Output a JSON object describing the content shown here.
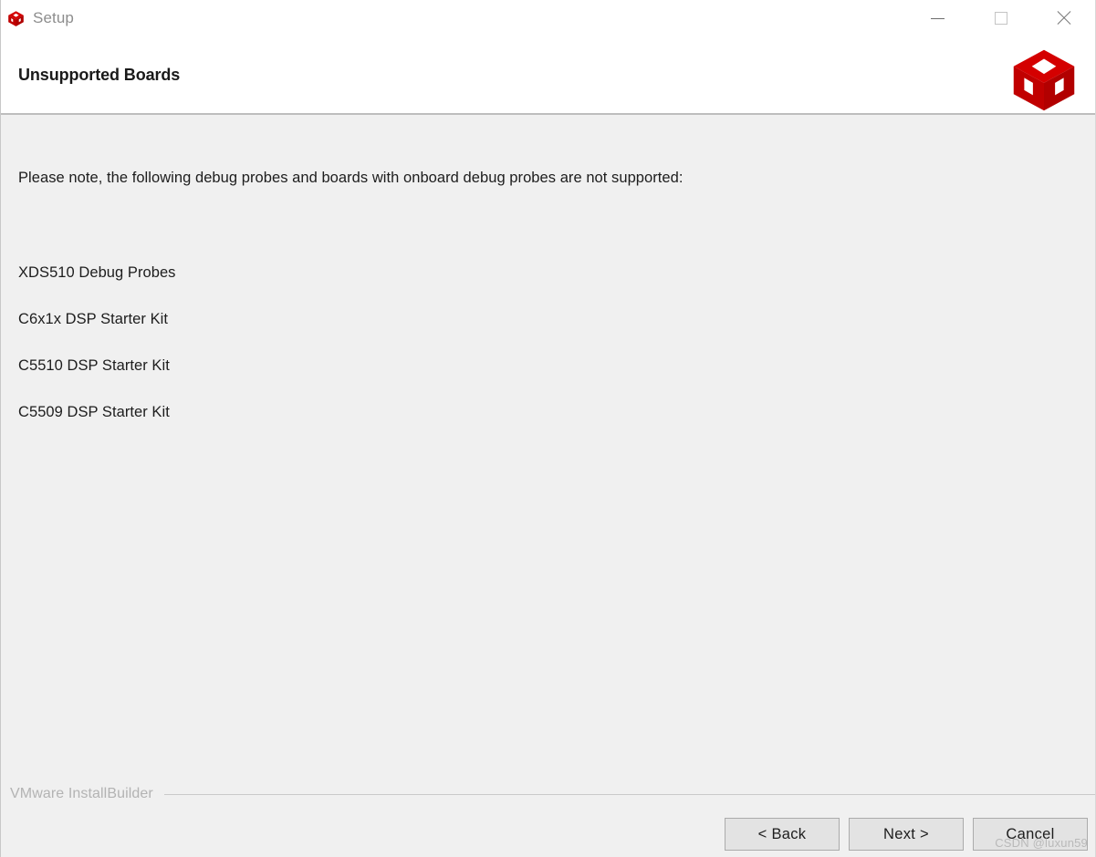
{
  "window": {
    "title": "Setup",
    "app_icon": "red-cube-icon",
    "controls": {
      "minimize": "minimize-icon",
      "maximize": "maximize-icon",
      "close": "close-icon"
    }
  },
  "header": {
    "title": "Unsupported Boards",
    "logo": "red-cube-logo",
    "logo_color": "#cc0000"
  },
  "main": {
    "intro": "Please note, the following debug probes and boards with onboard debug probes are not supported:",
    "boards": [
      "XDS510 Debug Probes",
      "C6x1x DSP Starter Kit",
      "C5510 DSP Starter Kit",
      "C5509 DSP Starter Kit"
    ]
  },
  "footer": {
    "brand": "VMware InstallBuilder",
    "buttons": {
      "back": "< Back",
      "next": "Next >",
      "cancel": "Cancel"
    },
    "watermark": "CSDN @luxun59"
  }
}
